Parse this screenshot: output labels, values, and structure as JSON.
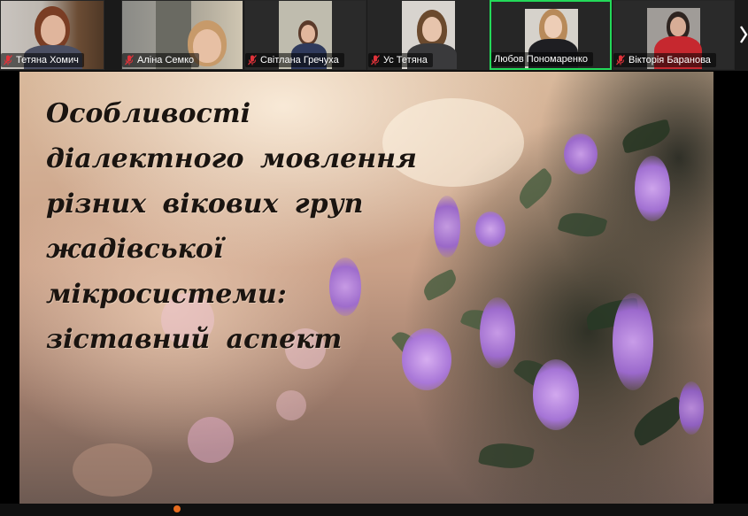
{
  "participants": [
    {
      "name": "Тетяна Хомич",
      "muted": true,
      "active": false
    },
    {
      "name": "Аліна Семко",
      "muted": true,
      "active": false
    },
    {
      "name": "Світлана Гречуха",
      "muted": true,
      "active": false
    },
    {
      "name": "Ус Тетяна",
      "muted": true,
      "active": false
    },
    {
      "name": "Любов Пономаренко",
      "muted": false,
      "active": true
    },
    {
      "name": "Вікторія Баранова",
      "muted": true,
      "active": false
    }
  ],
  "slide": {
    "title": "Особливості діалектного мовлення різних вікових груп жадівської мікросистеми: зіставний аспект"
  },
  "colors": {
    "active_speaker_border": "#23d959",
    "muted_mic": "#e0323a",
    "strip_background": "#1a1a1a"
  },
  "icons": {
    "muted": "mic-muted-icon"
  }
}
